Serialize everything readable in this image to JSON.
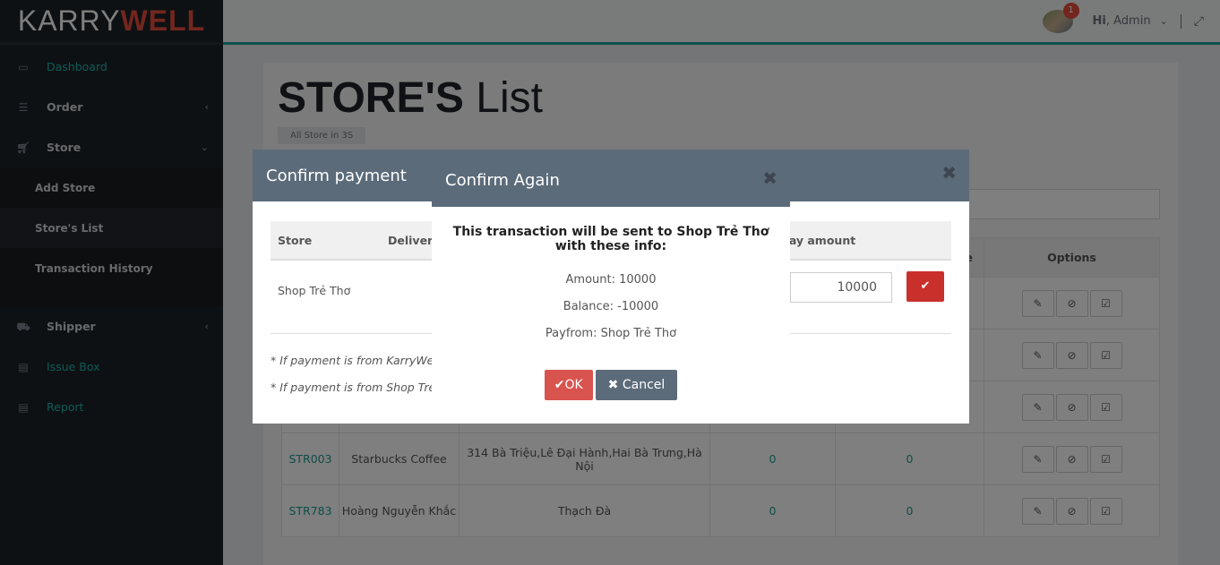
{
  "logo": {
    "part1": "KARRY",
    "part2": "WELL"
  },
  "sidebar": {
    "items": [
      {
        "label": "Dashboard",
        "icon": "laptop-icon"
      },
      {
        "label": "Order",
        "icon": "list-icon"
      },
      {
        "label": "Store",
        "icon": "cart-icon"
      },
      {
        "label": "Shipper",
        "icon": "truck-icon"
      },
      {
        "label": "Issue Box",
        "icon": "book-icon"
      },
      {
        "label": "Report",
        "icon": "book-icon"
      }
    ],
    "store_sub": [
      "Add Store",
      "Store's List",
      "Transaction History"
    ]
  },
  "header": {
    "notif_count": "1",
    "greeting": "Hi",
    "user": ", Admin"
  },
  "page": {
    "title_bold": "STORE'S",
    "title_light": " List",
    "crumb": "All Store in 3S"
  },
  "table": {
    "headers": {
      "col5": "e",
      "options": "Options"
    },
    "rows": [
      {
        "code": "",
        "name": "",
        "address": "",
        "v1": "",
        "v2": ""
      },
      {
        "code": "",
        "name": "",
        "address": "",
        "v1": "",
        "v2": ""
      },
      {
        "code": "",
        "name": "",
        "address": "",
        "v1": "",
        "v2": ""
      },
      {
        "code": "STR003",
        "name": "Starbucks Coffee",
        "address": "314 Bà Triệu,Lê Đại Hành,Hai Bà Trưng,Hà Nội",
        "v1": "0",
        "v2": "0"
      },
      {
        "code": "STR783",
        "name": "Hoàng Nguyễn Khắc",
        "address": "Thạch Đà",
        "v1": "0",
        "v2": "0"
      }
    ]
  },
  "modal1": {
    "title": "Confirm payment",
    "col_store": "Store",
    "col_delivery": "Delivery",
    "col_pay": "Pay amount",
    "store": "Shop Trẻ Thơ",
    "amount": "10000",
    "note1": "* If payment is from KarryWel",
    "note2": "* If payment is from Shop Trẻ"
  },
  "modal2": {
    "title": "Confirm Again",
    "message": "This transaction will be sent to Shop Trẻ Thơ with these info:",
    "amount": "Amount: 10000",
    "balance": "Balance: -10000",
    "payfrom": "Payfrom: Shop Trẻ Thơ",
    "ok": "OK",
    "cancel": "Cancel"
  }
}
